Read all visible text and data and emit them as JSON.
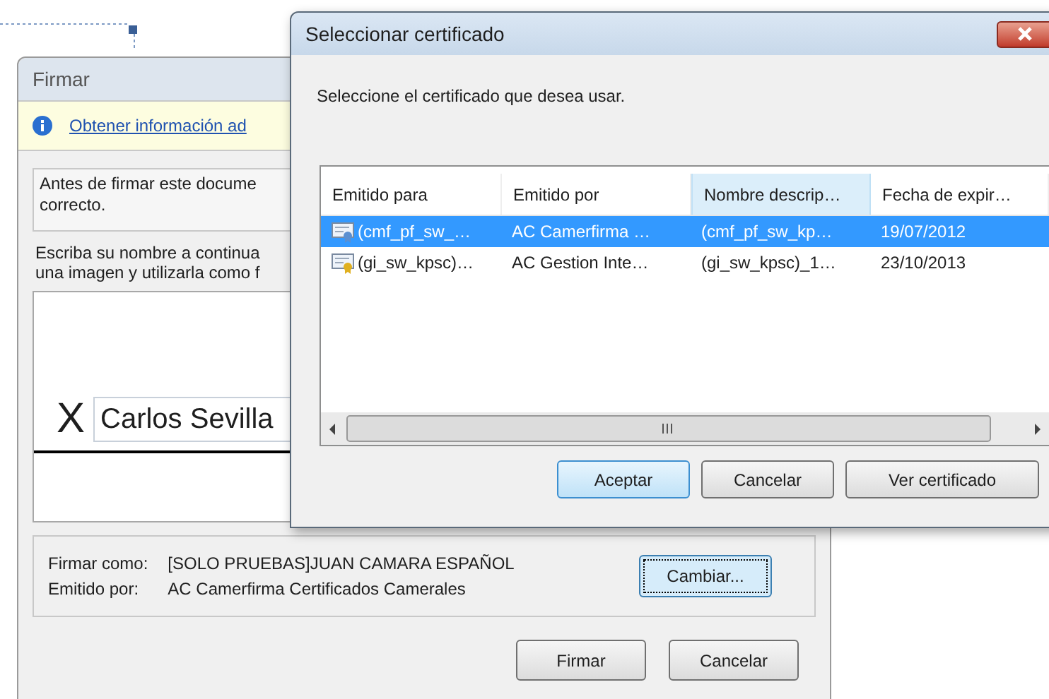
{
  "sign_dialog": {
    "title": "Firmar",
    "info_link": "Obtener información ad",
    "notice": "Antes de firmar este docume\ncorrecto.",
    "instruction": "Escriba su nombre a continua\nuna imagen y utilizarla como f",
    "signature_mark": "X",
    "signature_name": "Carlos Sevilla",
    "details": [
      {
        "label": "Firmar como:",
        "value": "[SOLO PRUEBAS]JUAN CAMARA ESPAÑOL"
      },
      {
        "label": "Emitido por:",
        "value": "AC Camerfirma Certificados Camerales"
      }
    ],
    "change_button": "Cambiar...",
    "buttons": [
      "Firmar",
      "Cancelar"
    ]
  },
  "certificate_dialog": {
    "title": "Seleccionar certificado",
    "prompt": "Seleccione el certificado que desea usar.",
    "columns": [
      {
        "label": "Emitido para",
        "sorted": false
      },
      {
        "label": "Emitido por",
        "sorted": false
      },
      {
        "label": "Nombre descrip…",
        "sorted": true
      },
      {
        "label": "Fecha de expir…",
        "sorted": false
      }
    ],
    "rows": [
      {
        "selected": true,
        "color": "#5b8fd0",
        "cells": [
          "(cmf_pf_sw_…",
          "AC Camerfirma …",
          "(cmf_pf_sw_kp…",
          "19/07/2012"
        ]
      },
      {
        "selected": false,
        "color": "#e0b020",
        "cells": [
          "(gi_sw_kpsc)…",
          "AC Gestion Inte…",
          "(gi_sw_kpsc)_1…",
          "23/10/2013"
        ]
      }
    ],
    "buttons": [
      {
        "label": "Aceptar",
        "default": true
      },
      {
        "label": "Cancelar",
        "default": false
      },
      {
        "label": "Ver certificado",
        "default": false
      }
    ]
  }
}
